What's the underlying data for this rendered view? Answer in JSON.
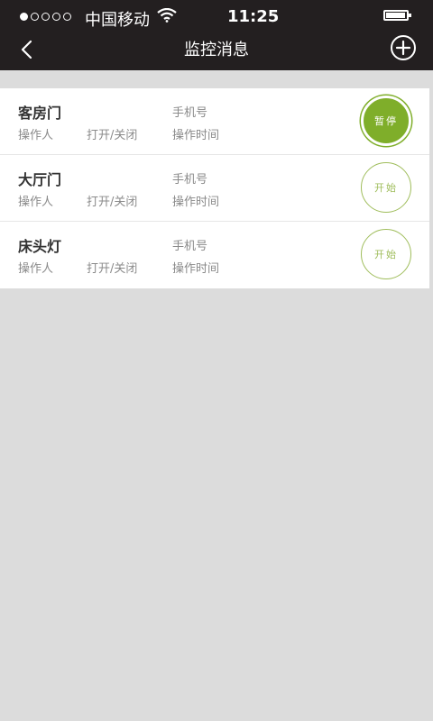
{
  "status_bar": {
    "carrier": "中国移动",
    "time": "11:25"
  },
  "nav": {
    "title": "监控消息",
    "back_icon": "chevron-left-icon",
    "add_icon": "plus-circle-icon"
  },
  "list": [
    {
      "device": "客房门",
      "operator": "操作人",
      "action": "打开/关闭",
      "phone": "手机号",
      "time": "操作时间",
      "button": "暂停",
      "state": "pause"
    },
    {
      "device": "大厅门",
      "operator": "操作人",
      "action": "打开/关闭",
      "phone": "手机号",
      "time": "操作时间",
      "button": "开始",
      "state": "start"
    },
    {
      "device": "床头灯",
      "operator": "操作人",
      "action": "打开/关闭",
      "phone": "手机号",
      "time": "操作时间",
      "button": "开始",
      "state": "start"
    }
  ],
  "colors": {
    "header_bg": "#231f20",
    "accent_green": "#7fae2a",
    "start_border": "#9fbd5b",
    "page_bg": "#dcdcdc"
  }
}
